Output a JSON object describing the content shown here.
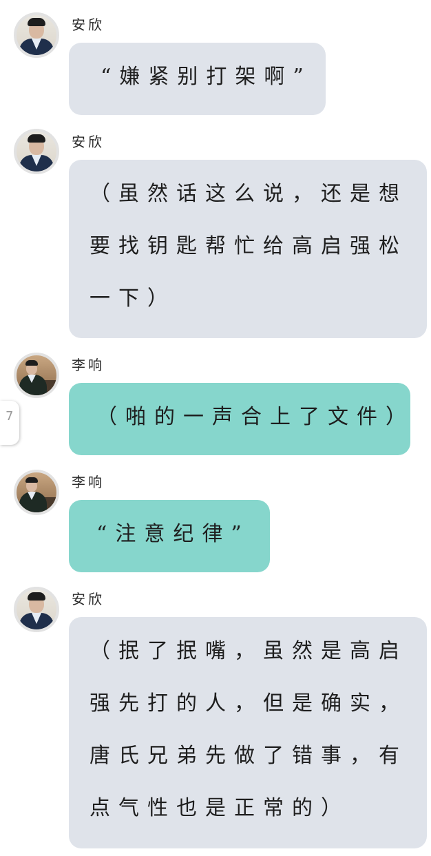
{
  "messages": [
    {
      "sender": "安欣",
      "text": "“嫌紧别打架啊”"
    },
    {
      "sender": "安欣",
      "lines": [
        "（虽然话这么说，还是想",
        "要找钥匙帮忙给高启强松",
        "一下）"
      ]
    },
    {
      "sender": "李响",
      "text": "（啪的一声合上了文件）"
    },
    {
      "sender": "李响",
      "text": "“注意纪律”"
    },
    {
      "sender": "安欣",
      "lines": [
        "（抿了抿嘴，虽然是高启",
        "强先打的人，但是确实，",
        "唐氏兄弟先做了错事，有",
        "点气性也是正常的）"
      ]
    }
  ],
  "edge_tab_glyph": "7",
  "colors": {
    "gray_bubble": "#dfe3ea",
    "teal_bubble": "#86d6cc"
  }
}
